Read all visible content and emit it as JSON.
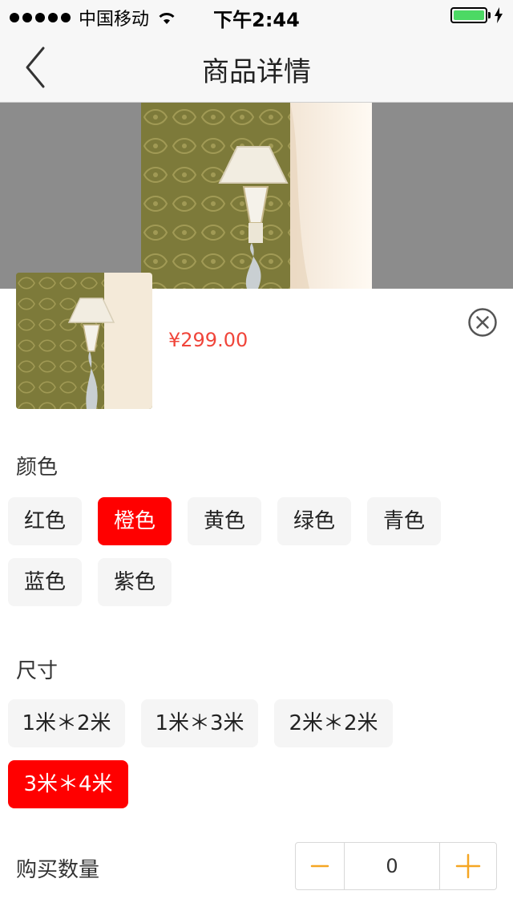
{
  "status_bar": {
    "carrier": "中国移动",
    "time": "下午2:44"
  },
  "nav": {
    "title": "商品详情"
  },
  "product": {
    "price": "¥299.00"
  },
  "color_section": {
    "title": "颜色",
    "options": [
      "红色",
      "橙色",
      "黄色",
      "绿色",
      "青色",
      "蓝色",
      "紫色"
    ],
    "selected": "橙色"
  },
  "size_section": {
    "title": "尺寸",
    "options": [
      "1米＊2米",
      "1米＊3米",
      "2米＊2米",
      "3米＊4米"
    ],
    "selected": "3米＊4米"
  },
  "quantity": {
    "label": "购买数量",
    "value": "0"
  },
  "colors": {
    "accent": "#ff0000",
    "price": "#f0453a",
    "stepper": "#f5a623"
  }
}
